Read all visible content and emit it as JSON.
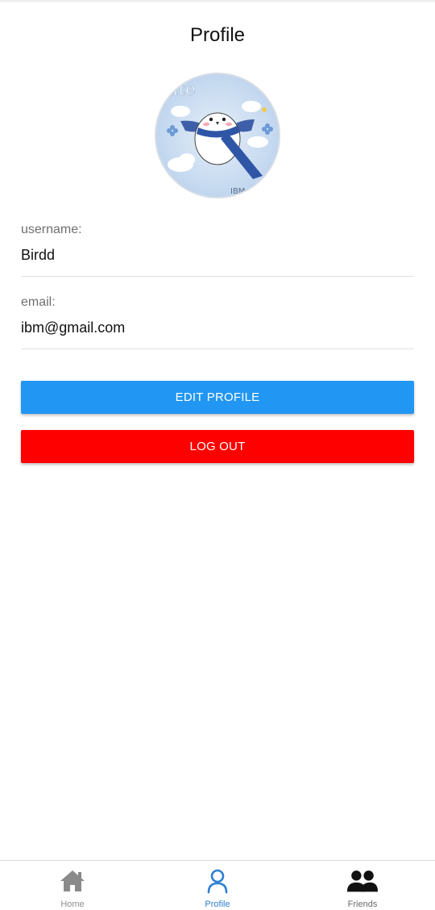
{
  "header": {
    "title": "Profile"
  },
  "profile": {
    "avatar_icon": "bird-avatar-image",
    "avatar_text": "white",
    "fields": {
      "username": {
        "label": "username:",
        "value": "Birdd"
      },
      "email": {
        "label": "email:",
        "value": "ibm@gmail.com"
      }
    }
  },
  "actions": {
    "edit_label": "EDIT PROFILE",
    "logout_label": "LOG OUT"
  },
  "tabs": [
    {
      "label": "Home",
      "icon": "home-icon",
      "active": false
    },
    {
      "label": "Profile",
      "icon": "person-icon",
      "active": true
    },
    {
      "label": "Friends",
      "icon": "friends-icon",
      "active": false
    }
  ],
  "colors": {
    "edit_button": "#2196f3",
    "logout_button": "#ff0000",
    "active_tab": "#2f80d1"
  }
}
